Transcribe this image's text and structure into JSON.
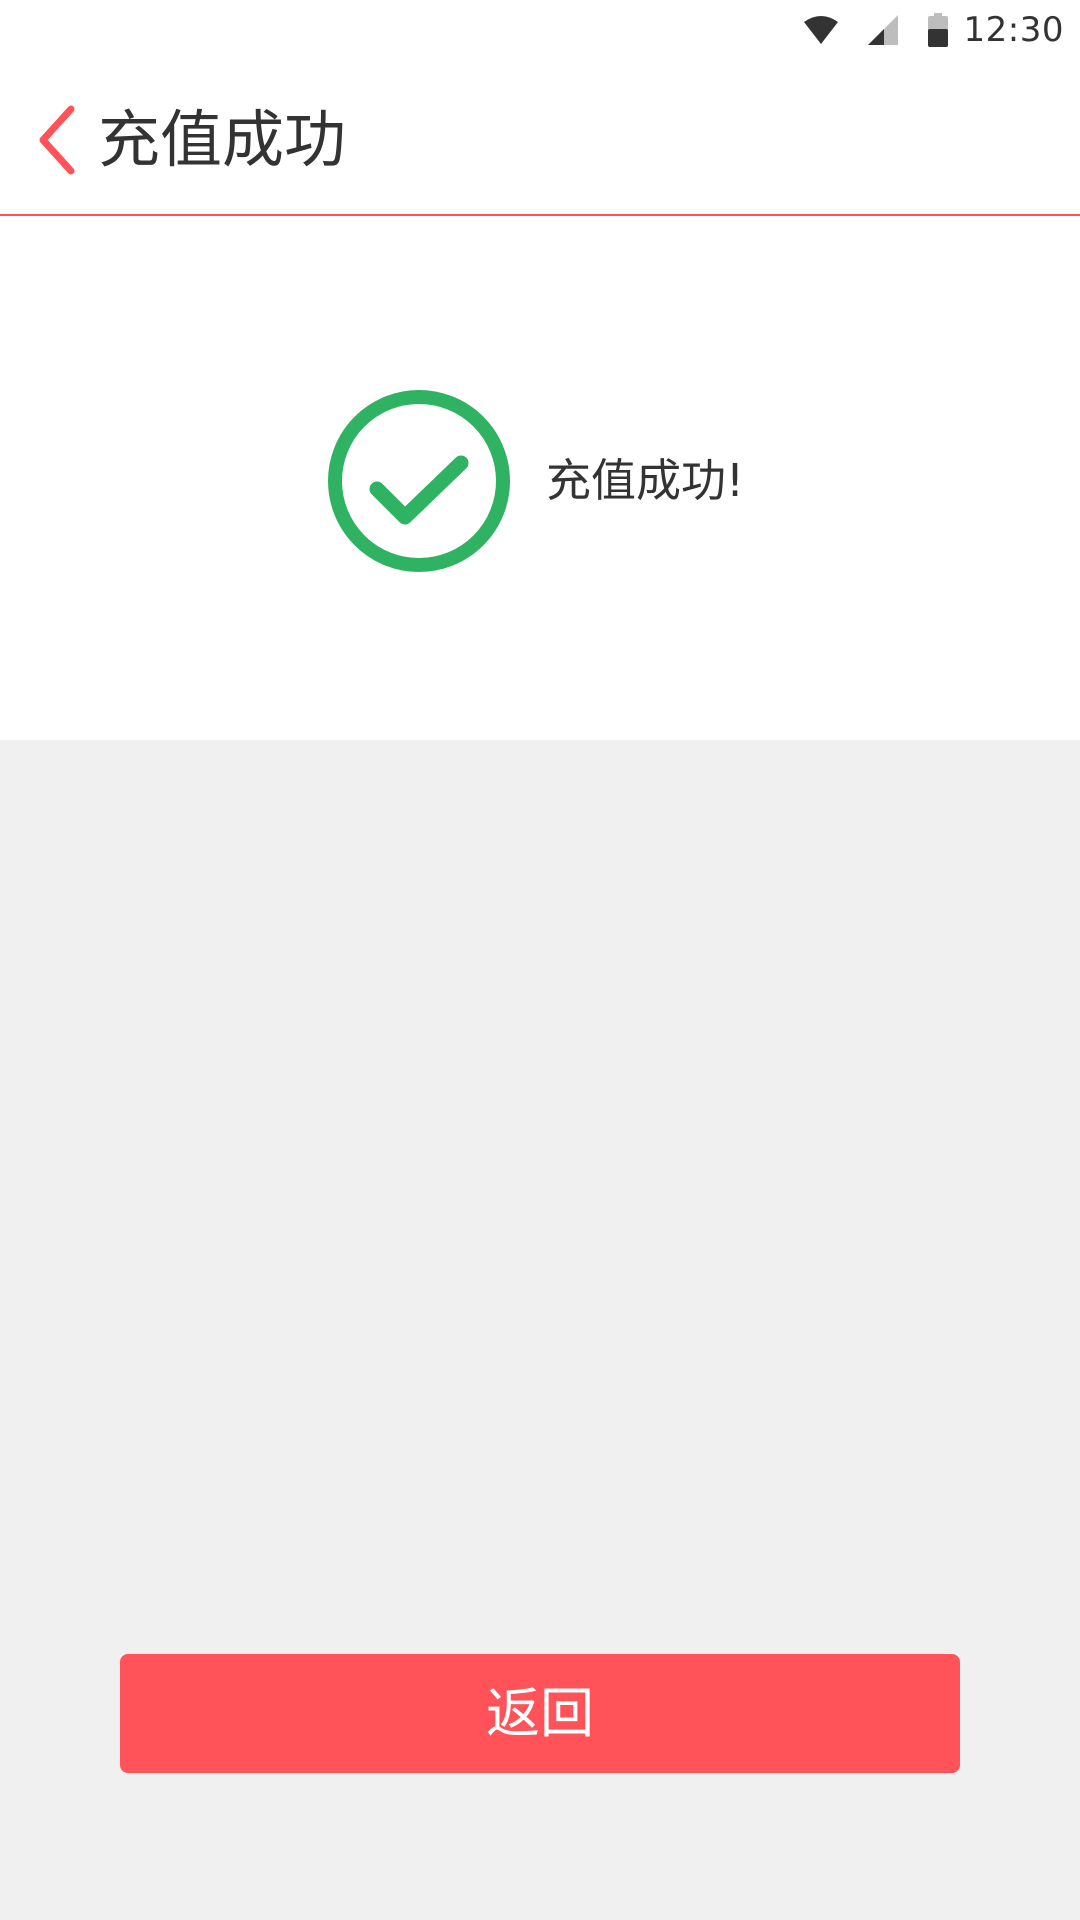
{
  "status_bar": {
    "time": "12:30",
    "icons": [
      "wifi-icon",
      "cell-signal-icon",
      "battery-icon"
    ]
  },
  "app_bar": {
    "title": "充值成功",
    "back_icon": "chevron-left-icon"
  },
  "result": {
    "icon": "check-circle-icon",
    "message": "充值成功!"
  },
  "actions": {
    "return_label": "返回"
  },
  "colors": {
    "accent": "#ff5359",
    "success": "#2fb261",
    "text": "#333333",
    "background": "#f0f0f0"
  }
}
